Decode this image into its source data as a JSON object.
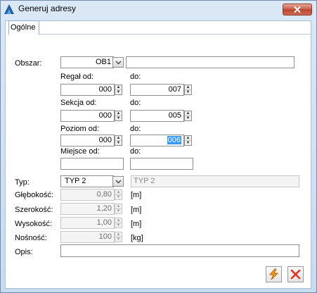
{
  "window": {
    "title": "Generuj adresy"
  },
  "tabs": [
    {
      "label": "Ogólne"
    }
  ],
  "form": {
    "obszar": {
      "label": "Obszar:",
      "value": "OB1",
      "description": ""
    },
    "regal": {
      "from_label": "Regał od:",
      "from_value": "000",
      "to_label": "do:",
      "to_value": "007"
    },
    "sekcja": {
      "from_label": "Sekcja od:",
      "from_value": "000",
      "to_label": "do:",
      "to_value": "005"
    },
    "poziom": {
      "from_label": "Poziom od:",
      "from_value": "000",
      "to_label": "do:",
      "to_value": "006"
    },
    "miejsce": {
      "from_label": "Miejsce od:",
      "from_value": "",
      "to_label": "do:",
      "to_value": ""
    },
    "typ": {
      "label": "Typ:",
      "value": "TYP 2",
      "description": "TYP 2"
    },
    "glebokosc": {
      "label": "Głębokość:",
      "value": "0,80",
      "unit": "[m]"
    },
    "szerokosc": {
      "label": "Szerokość:",
      "value": "1,20",
      "unit": "[m]"
    },
    "wysokosc": {
      "label": "Wysokość:",
      "value": "1,00",
      "unit": "[m]"
    },
    "nosnosc": {
      "label": "Nośność:",
      "value": "100",
      "unit": "[kg]"
    },
    "opis": {
      "label": "Opis:",
      "value": ""
    }
  },
  "buttons": {
    "generate_icon": "lightning-icon",
    "cancel_icon": "x-icon"
  },
  "colors": {
    "title_bar": "#cfe0f2",
    "close": "#c75b46",
    "selection": "#3399ff",
    "cancel_red": "#e8301e",
    "generate_orange": "#f2a321"
  }
}
